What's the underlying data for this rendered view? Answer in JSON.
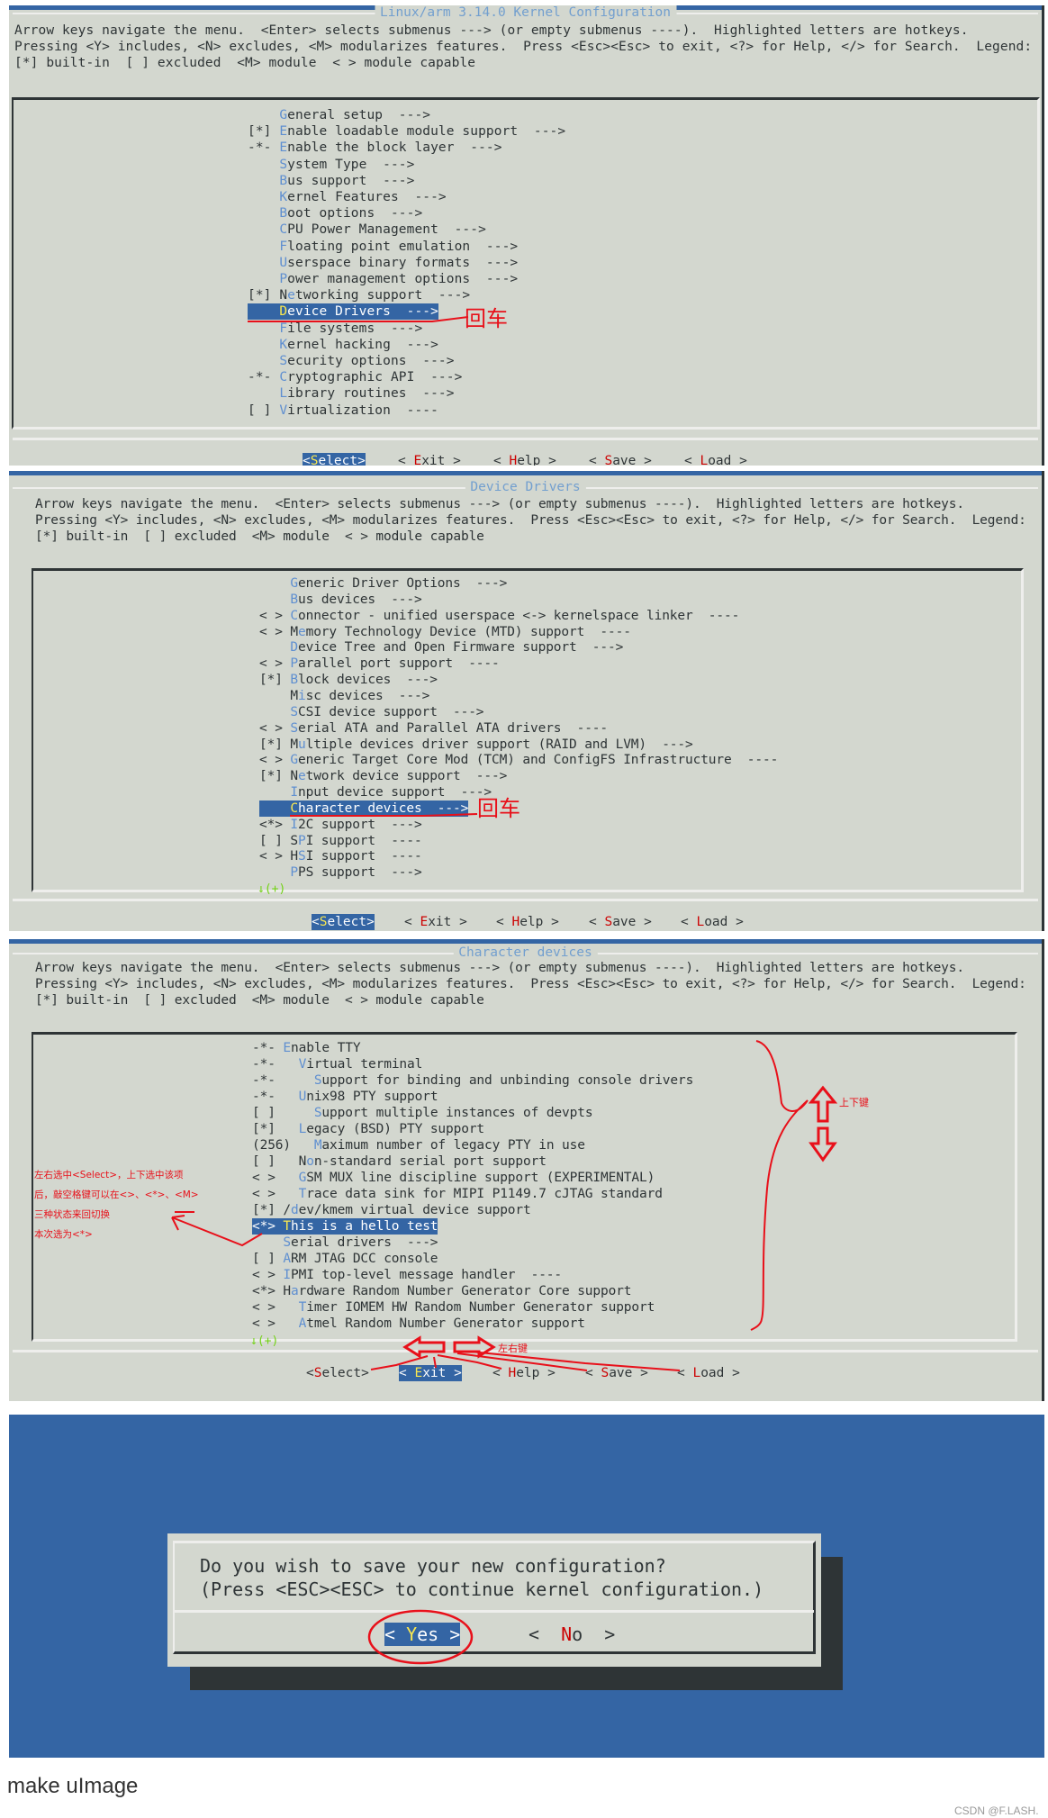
{
  "colors": {
    "panel_bg": "#d3d7cf",
    "accent_blue": "#3465a4",
    "hotkey": "#5f8fd0",
    "button_hotkey": "#cc0000",
    "selected_hotkey": "#fce94f",
    "annotation_red": "#e8101a"
  },
  "panels": [
    {
      "title": "Linux/arm 3.14.0 Kernel Configuration",
      "help": [
        "Arrow keys navigate the menu.  <Enter> selects submenus ---> (or empty submenus ----).  Highlighted letters are hotkeys.",
        "Pressing <Y> includes, <N> excludes, <M> modularizes features.  Press <Esc><Esc> to exit, <?> for Help, </> for Search.  Legend:",
        "[*] built-in  [ ] excluded  <M> module  < > module capable"
      ],
      "items": [
        {
          "line": "    General setup  --->",
          "hot": 4
        },
        {
          "line": "[*] Enable loadable module support  --->",
          "hot": 4
        },
        {
          "line": "-*- Enable the block layer  --->",
          "hot": 4
        },
        {
          "line": "    System Type  --->",
          "hot": 4
        },
        {
          "line": "    Bus support  --->",
          "hot": 4
        },
        {
          "line": "    Kernel Features  --->",
          "hot": 4
        },
        {
          "line": "    Boot options  --->",
          "hot": 4
        },
        {
          "line": "    CPU Power Management  --->",
          "hot": 4
        },
        {
          "line": "    Floating point emulation  --->",
          "hot": 4
        },
        {
          "line": "    Userspace binary formats  --->",
          "hot": 4
        },
        {
          "line": "    Power management options  --->",
          "hot": 4
        },
        {
          "line": "[*] Networking support  --->",
          "hot": 5
        },
        {
          "line": "    Device Drivers  --->",
          "hot": 4,
          "selected": true
        },
        {
          "line": "    File systems  --->",
          "hot": 4
        },
        {
          "line": "    Kernel hacking  --->",
          "hot": 4
        },
        {
          "line": "    Security options  --->",
          "hot": 4
        },
        {
          "line": "-*- Cryptographic API  --->",
          "hot": 4
        },
        {
          "line": "    Library routines  --->",
          "hot": 4
        },
        {
          "line": "[ ] Virtualization  ----",
          "hot": 4
        }
      ],
      "more": "",
      "buttons": [
        {
          "label": "<Select>",
          "hot": 1,
          "selected": true
        },
        {
          "label": "< Exit >",
          "hot": 2
        },
        {
          "label": "< Help >",
          "hot": 2
        },
        {
          "label": "< Save >",
          "hot": 2
        },
        {
          "label": "< Load >",
          "hot": 2
        }
      ]
    },
    {
      "title": "Device Drivers",
      "help": [
        "Arrow keys navigate the menu.  <Enter> selects submenus ---> (or empty submenus ----).  Highlighted letters are hotkeys.",
        "Pressing <Y> includes, <N> excludes, <M> modularizes features.  Press <Esc><Esc> to exit, <?> for Help, </> for Search.  Legend:",
        "[*] built-in  [ ] excluded  <M> module  < > module capable"
      ],
      "items": [
        {
          "line": "    Generic Driver Options  --->",
          "hot": 4
        },
        {
          "line": "    Bus devices  --->",
          "hot": 4
        },
        {
          "line": "< > Connector - unified userspace <-> kernelspace linker  ----",
          "hot": 4
        },
        {
          "line": "< > Memory Technology Device (MTD) support  ----",
          "hot": 5
        },
        {
          "line": "    Device Tree and Open Firmware support  --->",
          "hot": 4
        },
        {
          "line": "< > Parallel port support  ----",
          "hot": 4
        },
        {
          "line": "[*] Block devices  --->",
          "hot": 4
        },
        {
          "line": "    Misc devices  --->",
          "hot": 5
        },
        {
          "line": "    SCSI device support  --->",
          "hot": 4
        },
        {
          "line": "< > Serial ATA and Parallel ATA drivers  ----",
          "hot": 4
        },
        {
          "line": "[*] Multiple devices driver support (RAID and LVM)  --->",
          "hot": 5
        },
        {
          "line": "< > Generic Target Core Mod (TCM) and ConfigFS Infrastructure  ----",
          "hot": 4
        },
        {
          "line": "[*] Network device support  --->",
          "hot": 5
        },
        {
          "line": "    Input device support  --->",
          "hot": 4
        },
        {
          "line": "    Character devices  --->",
          "hot": 4,
          "selected": true
        },
        {
          "line": "<*> I2C support  --->",
          "hot": 4
        },
        {
          "line": "[ ] SPI support  ----",
          "hot": 5
        },
        {
          "line": "< > HSI support  ----",
          "hot": 5
        },
        {
          "line": "    PPS support  --->",
          "hot": 4
        }
      ],
      "more": "↓(+)",
      "buttons": [
        {
          "label": "<Select>",
          "hot": 1,
          "selected": true
        },
        {
          "label": "< Exit >",
          "hot": 2
        },
        {
          "label": "< Help >",
          "hot": 2
        },
        {
          "label": "< Save >",
          "hot": 2
        },
        {
          "label": "< Load >",
          "hot": 2
        }
      ]
    },
    {
      "title": "Character devices",
      "help": [
        "Arrow keys navigate the menu.  <Enter> selects submenus ---> (or empty submenus ----).  Highlighted letters are hotkeys.",
        "Pressing <Y> includes, <N> excludes, <M> modularizes features.  Press <Esc><Esc> to exit, <?> for Help, </> for Search.  Legend:",
        "[*] built-in  [ ] excluded  <M> module  < > module capable"
      ],
      "items": [
        {
          "line": "-*- Enable TTY",
          "hot": 4
        },
        {
          "line": "-*-   Virtual terminal",
          "hot": 6
        },
        {
          "line": "-*-     Support for binding and unbinding console drivers",
          "hot": 8
        },
        {
          "line": "-*-   Unix98 PTY support",
          "hot": 6
        },
        {
          "line": "[ ]     Support multiple instances of devpts",
          "hot": 8
        },
        {
          "line": "[*]   Legacy (BSD) PTY support",
          "hot": 6
        },
        {
          "line": "(256)   Maximum number of legacy PTY in use",
          "hot": 8
        },
        {
          "line": "[ ]   Non-standard serial port support",
          "hot": 7
        },
        {
          "line": "< >   GSM MUX line discipline support (EXPERIMENTAL)",
          "hot": 6
        },
        {
          "line": "< >   Trace data sink for MIPI P1149.7 cJTAG standard",
          "hot": 6
        },
        {
          "line": "[*] /dev/kmem virtual device support",
          "hot": 5
        },
        {
          "line": "<*> This is a hello test",
          "hot": 4,
          "selected": true
        },
        {
          "line": "    Serial drivers  --->",
          "hot": 4
        },
        {
          "line": "[ ] ARM JTAG DCC console",
          "hot": 4
        },
        {
          "line": "< > IPMI top-level message handler  ----",
          "hot": 4
        },
        {
          "line": "<*> Hardware Random Number Generator Core support",
          "hot": 5
        },
        {
          "line": "< >   Timer IOMEM HW Random Number Generator support",
          "hot": 6
        },
        {
          "line": "< >   Atmel Random Number Generator support",
          "hot": 6
        }
      ],
      "more": "↓(+)",
      "buttons": [
        {
          "label": "<Select>",
          "hot": 1
        },
        {
          "label": "< Exit >",
          "hot": 2,
          "selected": true
        },
        {
          "label": "< Help >",
          "hot": 2
        },
        {
          "label": "< Save >",
          "hot": 2
        },
        {
          "label": "< Load >",
          "hot": 2
        }
      ]
    }
  ],
  "annotations": {
    "p1_enter": "回车",
    "p2_enter": "回车",
    "updown_keys": "上下键",
    "leftright_keys": "左右键",
    "note": [
      "左右选中<Select>，上下选中该项",
      "后，敲空格键可以在<>、<*>、<M>",
      "三种状态来回切换",
      "本次选为<*>"
    ]
  },
  "dialog": {
    "lines": [
      "Do you wish to save your new configuration?",
      "(Press <ESC><ESC> to continue kernel configuration.)"
    ],
    "buttons": [
      {
        "label": "< Yes >",
        "hot": 2,
        "selected": true
      },
      {
        "label": "<  No  >",
        "hot": 3
      }
    ]
  },
  "footer": {
    "heading": "make uImage",
    "watermark": "CSDN @F.LASH."
  }
}
